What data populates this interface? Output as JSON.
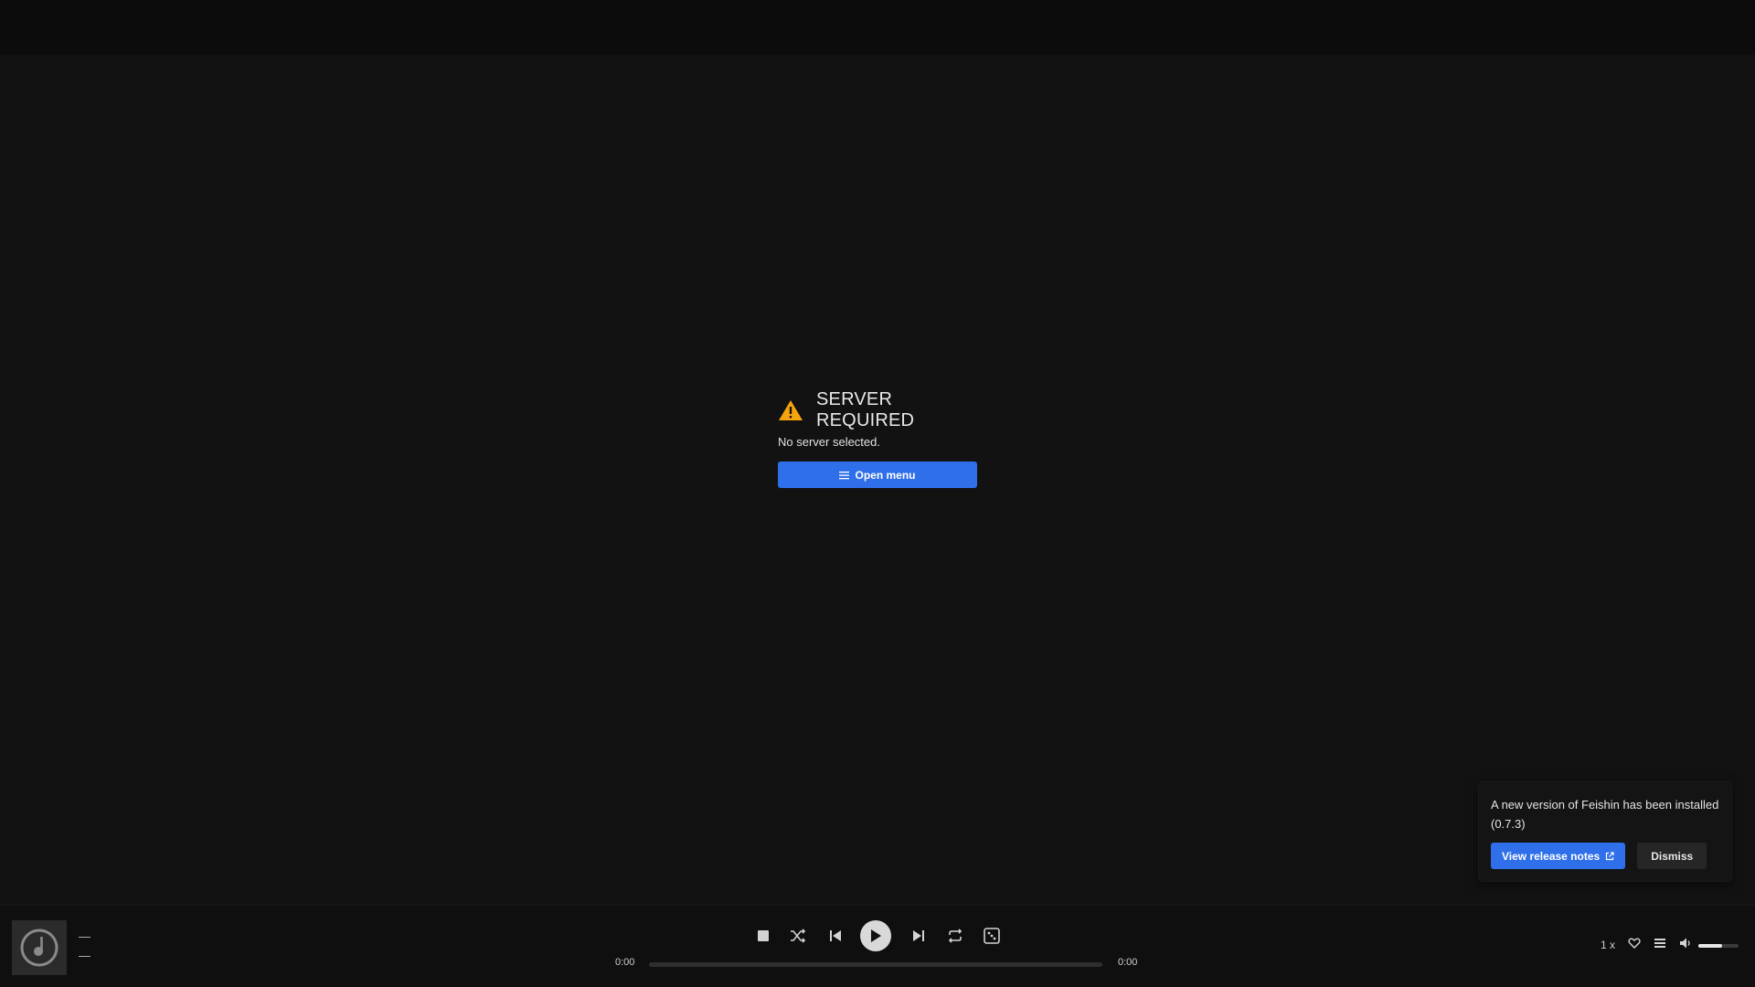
{
  "error": {
    "title": "SERVER REQUIRED",
    "message": "No server selected.",
    "button_label": "Open menu"
  },
  "toast": {
    "message": "A new version of Feishin has been installed (0.7.3)",
    "release_label": "View release notes",
    "dismiss_label": "Dismiss"
  },
  "player": {
    "track_title": "—",
    "track_artist": "—",
    "elapsed": "0:00",
    "duration": "0:00",
    "speed": "1 x",
    "volume_fraction": 0.6
  },
  "colors": {
    "accent": "#2f6fea",
    "warning": "#f5a40c",
    "background": "#121212"
  }
}
